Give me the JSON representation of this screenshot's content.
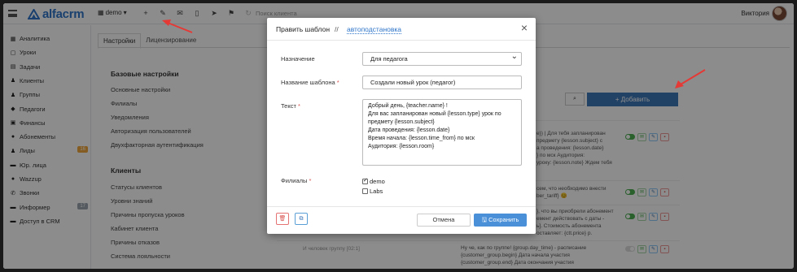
{
  "topbar": {
    "logo": "alfacrm",
    "branch": "demo",
    "branch_caret": "▾",
    "search_placeholder": "Поиск клиента",
    "user_name": "Виктория"
  },
  "sidebar": {
    "items": [
      {
        "label": "Аналитика",
        "icon": "▦"
      },
      {
        "label": "Уроки",
        "icon": "▢"
      },
      {
        "label": "Задачи",
        "icon": "▤"
      },
      {
        "label": "Клиенты",
        "icon": "♟"
      },
      {
        "label": "Группы",
        "icon": "♟"
      },
      {
        "label": "Педагоги",
        "icon": "◆"
      },
      {
        "label": "Финансы",
        "icon": "▣"
      },
      {
        "label": "Абонементы",
        "icon": "●"
      },
      {
        "label": "Лиды",
        "icon": "♟",
        "badge": "16"
      },
      {
        "label": "Юр. лица",
        "icon": "▬"
      },
      {
        "label": "Wazzup",
        "icon": "●"
      },
      {
        "label": "Звонки",
        "icon": "✆"
      },
      {
        "label": "Информер",
        "icon": "▬",
        "badge": "17"
      },
      {
        "label": "Доступ в CRM",
        "icon": "▬"
      }
    ]
  },
  "settings": {
    "tabs": [
      "Настройки",
      "Лицензирование"
    ],
    "groups": [
      {
        "heading": "Базовые настройки",
        "links": [
          "Основные настройки",
          "Филиалы",
          "Уведомления",
          "Авторизация пользователей",
          "Двухфакторная аутентификация"
        ]
      },
      {
        "heading": "Клиенты",
        "links": [
          "Статусы клиентов",
          "Уровни знаний",
          "Причины пропуска уроков",
          "Кабинет клиента",
          "Причины отказов",
          "Система лояльности"
        ]
      }
    ]
  },
  "background_table": {
    "search_icon": "⌕",
    "add_button": "+ Добавить",
    "rows": [
      {
        "text": [
          "e}) | Для тебя запланирован",
          "предмету {lesson.subject} с",
          "а проведения: {lesson.date}",
          "} по мск Аудитория:",
          "уроку: {lesson.note} Ждем тебя"
        ],
        "toggle": true
      },
      {
        "text": [
          "сем, что необходимо внести",
          "ber_tariff} 😊"
        ],
        "toggle": true
      },
      {
        "text": [
          "}, что вы приобрели абонемент",
          "емент действовать с даты -",
          "ь]. Стоимость абонемента",
          "оставляет: {ctt.price} р."
        ],
        "toggle": true
      },
      {
        "left": "И человек группу  [02:1]",
        "text": [
          "Ну че, как по группе! {group.day_time} - расписание",
          "{customer_group.begin} Дата начала участия",
          "{customer_group.end} Дата окончания участия"
        ],
        "toggle": false
      }
    ]
  },
  "modal": {
    "title": "Править шаблон",
    "separator": "//",
    "tab": "автоподстановка",
    "close": "×",
    "fields": {
      "purpose_label": "Назначение",
      "purpose_value": "Для педагога",
      "name_label": "Название шаблона",
      "name_value": "Создали новый урок (педагог)",
      "text_label": "Текст",
      "text_lines": [
        "Добрый день, {teacher.name} !",
        "Для вас запланирован новый {lesson.type} урок по",
        "предмету {lesson.subject}",
        "Дата проведения: {lesson.date}",
        "Время начала: {lesson.time_from} по мск",
        "Аудитория: {lesson.room}"
      ],
      "branches_label": "Филиалы",
      "required_mark": "*",
      "branches": [
        {
          "label": "demo",
          "checked": true
        },
        {
          "label": "Labs",
          "checked": false
        }
      ]
    },
    "buttons": {
      "delete_icon": "🗑",
      "copy_icon": "⧉",
      "cancel": "Отмена",
      "save": "🖫 Сохранить"
    }
  },
  "colors": {
    "brand_blue": "#2e75c9",
    "primary_button": "#4a90d9",
    "add_button": "#3f79b9",
    "required": "#d9534f",
    "arrow_red": "#e53935"
  }
}
